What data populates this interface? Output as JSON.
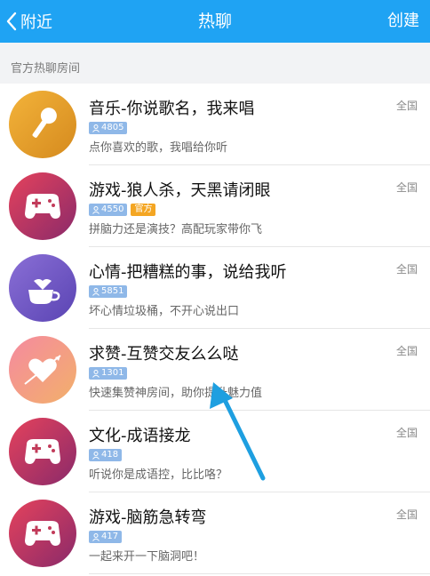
{
  "header": {
    "back_label": "附近",
    "title": "热聊",
    "create_label": "创建"
  },
  "section_title": "官方热聊房间",
  "rooms": [
    {
      "name": "音乐-你说歌名，我来唱",
      "region": "全国",
      "count": "4805",
      "tag": "",
      "desc": "点你喜欢的歌，我唱给你听",
      "icon": "microphone-icon",
      "color1": "#f3b33a",
      "color2": "#d58a1e"
    },
    {
      "name": "游戏-狼人杀，天黑请闭眼",
      "region": "全国",
      "count": "4550",
      "tag": "官方",
      "desc": "拼脑力还是演技？高配玩家带你飞",
      "icon": "gamepad-icon",
      "color1": "#e5425c",
      "color2": "#8a2a6a"
    },
    {
      "name": "心情-把糟糕的事，说给我听",
      "region": "全国",
      "count": "5851",
      "tag": "",
      "desc": "坏心情垃圾桶，不开心说出口",
      "icon": "coffee-cup-icon",
      "color1": "#8a6fd6",
      "color2": "#5a44b3"
    },
    {
      "name": "求赞-互赞交友么么哒",
      "region": "全国",
      "count": "1301",
      "tag": "",
      "desc": "快速集赞神房间，助你提升魅力值",
      "icon": "heart-arrow-icon",
      "color1": "#f58aa0",
      "color2": "#f2b06a"
    },
    {
      "name": "文化-成语接龙",
      "region": "全国",
      "count": "418",
      "tag": "",
      "desc": "听说你是成语控，比比咯？",
      "icon": "gamepad-icon",
      "color1": "#e5425c",
      "color2": "#8a2a6a"
    },
    {
      "name": "游戏-脑筋急转弯",
      "region": "全国",
      "count": "417",
      "tag": "",
      "desc": "一起来开一下脑洞吧！",
      "icon": "gamepad-icon",
      "color1": "#e5425c",
      "color2": "#8a2a6a"
    }
  ],
  "colors": {
    "header": "#1fa3f3",
    "count_badge": "#8fb8e8",
    "tag_badge": "#f4a623",
    "annotation_arrow": "#1e9fe0"
  }
}
